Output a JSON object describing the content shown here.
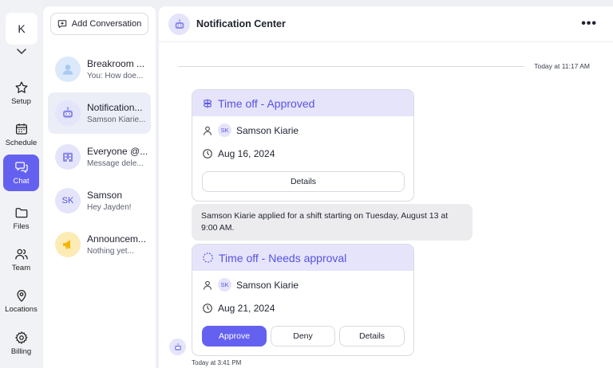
{
  "workspace": {
    "initial": "K"
  },
  "nav": [
    {
      "label": "Setup",
      "icon": "star-icon"
    },
    {
      "label": "Schedule",
      "icon": "calendar-icon"
    },
    {
      "label": "Chat",
      "icon": "chat-icon",
      "active": true
    },
    {
      "label": "Files",
      "icon": "folder-icon"
    },
    {
      "label": "Team",
      "icon": "team-icon"
    },
    {
      "label": "Locations",
      "icon": "location-pin-icon"
    },
    {
      "label": "Billing",
      "icon": "gear-icon"
    }
  ],
  "conversations": {
    "add_label": "Add Conversation",
    "items": [
      {
        "name": "Breakroom ...",
        "preview": "You: How doe...",
        "avatar": "person-avatar-icon"
      },
      {
        "name": "Notification...",
        "preview": "Samson Kiarie...",
        "avatar": "bot-icon",
        "active": true
      },
      {
        "name": "Everyone @...",
        "preview": "Message dele...",
        "avatar": "building-icon"
      },
      {
        "name": "Samson",
        "preview": "Hey Jayden!",
        "avatar_text": "SK"
      },
      {
        "name": "Announcem...",
        "preview": "Nothing yet...",
        "avatar": "megaphone-icon"
      }
    ]
  },
  "chat": {
    "title": "Notification Center",
    "more": "•••",
    "divider_time": "Today at 11:17 AM",
    "card1": {
      "title": "Time off - Approved",
      "person_initials": "SK",
      "person_name": "Samson Kiarie",
      "date": "Aug 16, 2024",
      "details_label": "Details"
    },
    "system_message": "Samson Kiarie applied for a shift starting on Tuesday, August 13 at 9:00 AM.",
    "card2": {
      "title": "Time off - Needs approval",
      "person_initials": "SK",
      "person_name": "Samson Kiarie",
      "date": "Aug 21, 2024",
      "approve_label": "Approve",
      "deny_label": "Deny",
      "details_label": "Details"
    },
    "bottom_time": "Today at 3:41 PM"
  },
  "colors": {
    "accent": "#6561f0",
    "card_header_bg": "#e6e4fb",
    "card_header_text": "#5753e0",
    "rail_bg": "#f1f2f5"
  }
}
